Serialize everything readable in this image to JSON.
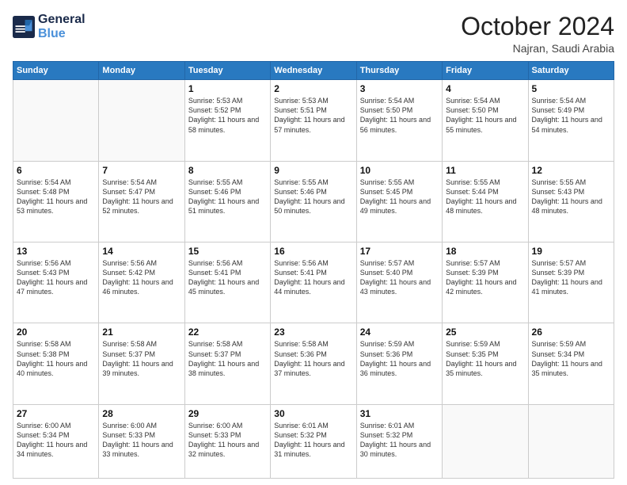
{
  "header": {
    "logo_line1": "General",
    "logo_line2": "Blue",
    "month": "October 2024",
    "location": "Najran, Saudi Arabia"
  },
  "weekdays": [
    "Sunday",
    "Monday",
    "Tuesday",
    "Wednesday",
    "Thursday",
    "Friday",
    "Saturday"
  ],
  "weeks": [
    [
      {
        "day": "",
        "sunrise": "",
        "sunset": "",
        "daylight": ""
      },
      {
        "day": "",
        "sunrise": "",
        "sunset": "",
        "daylight": ""
      },
      {
        "day": "1",
        "sunrise": "Sunrise: 5:53 AM",
        "sunset": "Sunset: 5:52 PM",
        "daylight": "Daylight: 11 hours and 58 minutes."
      },
      {
        "day": "2",
        "sunrise": "Sunrise: 5:53 AM",
        "sunset": "Sunset: 5:51 PM",
        "daylight": "Daylight: 11 hours and 57 minutes."
      },
      {
        "day": "3",
        "sunrise": "Sunrise: 5:54 AM",
        "sunset": "Sunset: 5:50 PM",
        "daylight": "Daylight: 11 hours and 56 minutes."
      },
      {
        "day": "4",
        "sunrise": "Sunrise: 5:54 AM",
        "sunset": "Sunset: 5:50 PM",
        "daylight": "Daylight: 11 hours and 55 minutes."
      },
      {
        "day": "5",
        "sunrise": "Sunrise: 5:54 AM",
        "sunset": "Sunset: 5:49 PM",
        "daylight": "Daylight: 11 hours and 54 minutes."
      }
    ],
    [
      {
        "day": "6",
        "sunrise": "Sunrise: 5:54 AM",
        "sunset": "Sunset: 5:48 PM",
        "daylight": "Daylight: 11 hours and 53 minutes."
      },
      {
        "day": "7",
        "sunrise": "Sunrise: 5:54 AM",
        "sunset": "Sunset: 5:47 PM",
        "daylight": "Daylight: 11 hours and 52 minutes."
      },
      {
        "day": "8",
        "sunrise": "Sunrise: 5:55 AM",
        "sunset": "Sunset: 5:46 PM",
        "daylight": "Daylight: 11 hours and 51 minutes."
      },
      {
        "day": "9",
        "sunrise": "Sunrise: 5:55 AM",
        "sunset": "Sunset: 5:46 PM",
        "daylight": "Daylight: 11 hours and 50 minutes."
      },
      {
        "day": "10",
        "sunrise": "Sunrise: 5:55 AM",
        "sunset": "Sunset: 5:45 PM",
        "daylight": "Daylight: 11 hours and 49 minutes."
      },
      {
        "day": "11",
        "sunrise": "Sunrise: 5:55 AM",
        "sunset": "Sunset: 5:44 PM",
        "daylight": "Daylight: 11 hours and 48 minutes."
      },
      {
        "day": "12",
        "sunrise": "Sunrise: 5:55 AM",
        "sunset": "Sunset: 5:43 PM",
        "daylight": "Daylight: 11 hours and 48 minutes."
      }
    ],
    [
      {
        "day": "13",
        "sunrise": "Sunrise: 5:56 AM",
        "sunset": "Sunset: 5:43 PM",
        "daylight": "Daylight: 11 hours and 47 minutes."
      },
      {
        "day": "14",
        "sunrise": "Sunrise: 5:56 AM",
        "sunset": "Sunset: 5:42 PM",
        "daylight": "Daylight: 11 hours and 46 minutes."
      },
      {
        "day": "15",
        "sunrise": "Sunrise: 5:56 AM",
        "sunset": "Sunset: 5:41 PM",
        "daylight": "Daylight: 11 hours and 45 minutes."
      },
      {
        "day": "16",
        "sunrise": "Sunrise: 5:56 AM",
        "sunset": "Sunset: 5:41 PM",
        "daylight": "Daylight: 11 hours and 44 minutes."
      },
      {
        "day": "17",
        "sunrise": "Sunrise: 5:57 AM",
        "sunset": "Sunset: 5:40 PM",
        "daylight": "Daylight: 11 hours and 43 minutes."
      },
      {
        "day": "18",
        "sunrise": "Sunrise: 5:57 AM",
        "sunset": "Sunset: 5:39 PM",
        "daylight": "Daylight: 11 hours and 42 minutes."
      },
      {
        "day": "19",
        "sunrise": "Sunrise: 5:57 AM",
        "sunset": "Sunset: 5:39 PM",
        "daylight": "Daylight: 11 hours and 41 minutes."
      }
    ],
    [
      {
        "day": "20",
        "sunrise": "Sunrise: 5:58 AM",
        "sunset": "Sunset: 5:38 PM",
        "daylight": "Daylight: 11 hours and 40 minutes."
      },
      {
        "day": "21",
        "sunrise": "Sunrise: 5:58 AM",
        "sunset": "Sunset: 5:37 PM",
        "daylight": "Daylight: 11 hours and 39 minutes."
      },
      {
        "day": "22",
        "sunrise": "Sunrise: 5:58 AM",
        "sunset": "Sunset: 5:37 PM",
        "daylight": "Daylight: 11 hours and 38 minutes."
      },
      {
        "day": "23",
        "sunrise": "Sunrise: 5:58 AM",
        "sunset": "Sunset: 5:36 PM",
        "daylight": "Daylight: 11 hours and 37 minutes."
      },
      {
        "day": "24",
        "sunrise": "Sunrise: 5:59 AM",
        "sunset": "Sunset: 5:36 PM",
        "daylight": "Daylight: 11 hours and 36 minutes."
      },
      {
        "day": "25",
        "sunrise": "Sunrise: 5:59 AM",
        "sunset": "Sunset: 5:35 PM",
        "daylight": "Daylight: 11 hours and 35 minutes."
      },
      {
        "day": "26",
        "sunrise": "Sunrise: 5:59 AM",
        "sunset": "Sunset: 5:34 PM",
        "daylight": "Daylight: 11 hours and 35 minutes."
      }
    ],
    [
      {
        "day": "27",
        "sunrise": "Sunrise: 6:00 AM",
        "sunset": "Sunset: 5:34 PM",
        "daylight": "Daylight: 11 hours and 34 minutes."
      },
      {
        "day": "28",
        "sunrise": "Sunrise: 6:00 AM",
        "sunset": "Sunset: 5:33 PM",
        "daylight": "Daylight: 11 hours and 33 minutes."
      },
      {
        "day": "29",
        "sunrise": "Sunrise: 6:00 AM",
        "sunset": "Sunset: 5:33 PM",
        "daylight": "Daylight: 11 hours and 32 minutes."
      },
      {
        "day": "30",
        "sunrise": "Sunrise: 6:01 AM",
        "sunset": "Sunset: 5:32 PM",
        "daylight": "Daylight: 11 hours and 31 minutes."
      },
      {
        "day": "31",
        "sunrise": "Sunrise: 6:01 AM",
        "sunset": "Sunset: 5:32 PM",
        "daylight": "Daylight: 11 hours and 30 minutes."
      },
      {
        "day": "",
        "sunrise": "",
        "sunset": "",
        "daylight": ""
      },
      {
        "day": "",
        "sunrise": "",
        "sunset": "",
        "daylight": ""
      }
    ]
  ]
}
